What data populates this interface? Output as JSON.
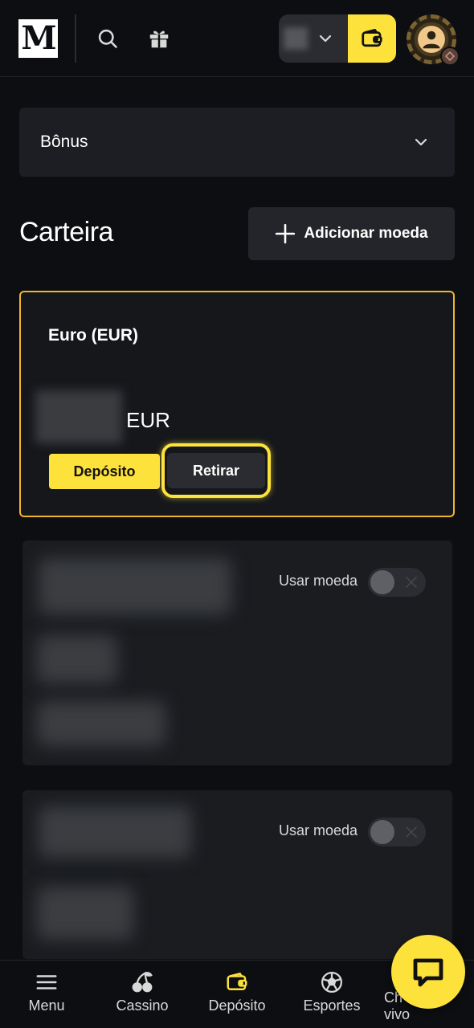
{
  "header": {
    "logo_text": "M",
    "accent_color": "#fde23b"
  },
  "bonus": {
    "label": "Bônus"
  },
  "wallet": {
    "title": "Carteira",
    "add_currency_label": "Adicionar moeda"
  },
  "eur_card": {
    "name": "Euro (EUR)",
    "currency_code": "EUR",
    "deposit_label": "Depósito",
    "withdraw_label": "Retirar"
  },
  "currency_cards": [
    {
      "use_label": "Usar moeda",
      "toggle_on": false
    },
    {
      "use_label": "Usar moeda",
      "toggle_on": false
    }
  ],
  "bottom_nav": {
    "items": [
      {
        "label": "Menu",
        "icon": "menu-icon"
      },
      {
        "label": "Cassino",
        "icon": "cherries-icon"
      },
      {
        "label": "Depósito",
        "icon": "wallet-icon"
      },
      {
        "label": "Esportes",
        "icon": "soccer-ball-icon"
      },
      {
        "label": "Chat ao vivo",
        "icon": "chat-icon"
      }
    ],
    "chat_visible_label_line1": "Ch",
    "chat_visible_label_line2": "vivo"
  }
}
